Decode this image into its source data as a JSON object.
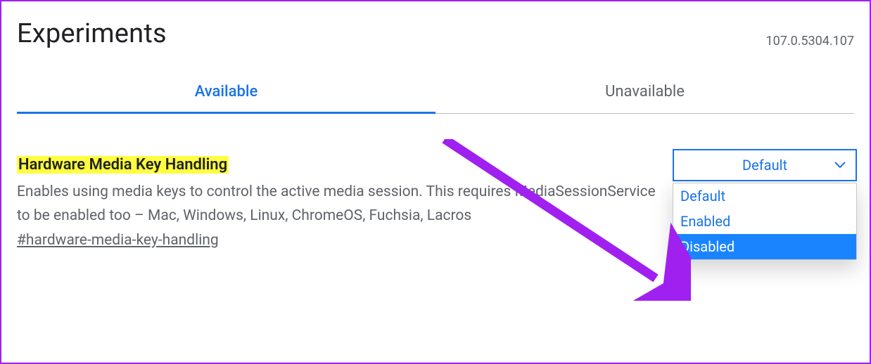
{
  "header": {
    "title": "Experiments",
    "version": "107.0.5304.107"
  },
  "tabs": [
    {
      "label": "Available",
      "active": true
    },
    {
      "label": "Unavailable",
      "active": false
    }
  ],
  "experiment": {
    "title": "Hardware Media Key Handling",
    "description": "Enables using media keys to control the active media session. This requires MediaSessionService to be enabled too – Mac, Windows, Linux, ChromeOS, Fuchsia, Lacros",
    "anchor": "#hardware-media-key-handling",
    "select": {
      "value": "Default",
      "options": [
        "Default",
        "Enabled",
        "Disabled"
      ],
      "highlighted": "Disabled"
    }
  },
  "annotation": {
    "color": "#a020f0"
  }
}
